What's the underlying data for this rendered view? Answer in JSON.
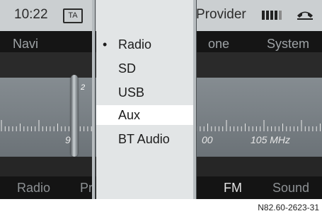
{
  "status": {
    "time": "10:22",
    "ta_badge": "TA",
    "provider": "Provider",
    "icons": [
      "signal-strength-icon",
      "phone-handset-icon"
    ]
  },
  "menu": {
    "navi": "Navi",
    "phone_partial": "one",
    "system": "System"
  },
  "tuner": {
    "preset_number": "2",
    "freq_left_partial": "9",
    "freq_mid_partial": "00",
    "freq_right": "105 MHz"
  },
  "softkeys": {
    "radio": "Radio",
    "partial": "Pr",
    "fm": "FM",
    "sound": "Sound"
  },
  "source_menu": {
    "items": [
      {
        "label": "Radio",
        "marked": true
      },
      {
        "label": "SD",
        "marked": false
      },
      {
        "label": "USB",
        "marked": false
      },
      {
        "label": "Aux",
        "marked": false,
        "highlighted": true
      },
      {
        "label": "BT Audio",
        "marked": false
      }
    ],
    "bullet": "•"
  },
  "caption": "N82.60-2623-31",
  "colors": {
    "status_bar": "#cbcfd1",
    "tuner_band": "#7a8186",
    "dropdown_bg": "#e2e5e6",
    "highlight": "#ffffff"
  }
}
